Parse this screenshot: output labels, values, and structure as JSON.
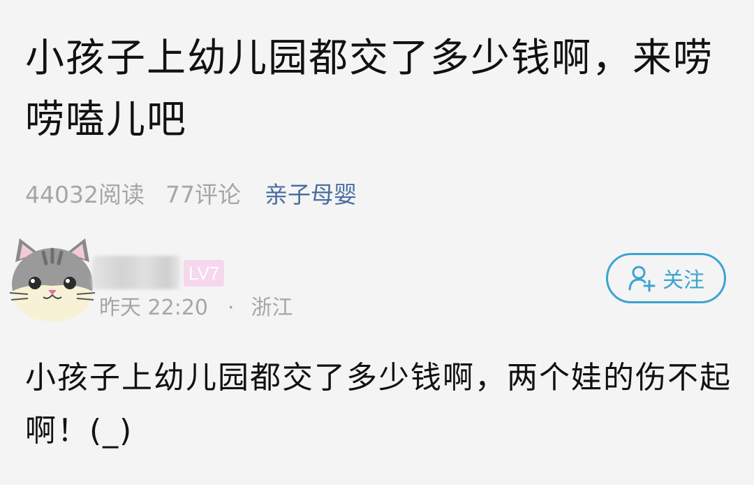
{
  "post": {
    "title": "小孩子上幼儿园都交了多少钱啊，来唠唠嗑儿吧",
    "reads": "44032阅读",
    "comments": "77评论",
    "category": "亲子母婴"
  },
  "comment": {
    "level": "LV7",
    "time": "昨天 22:20",
    "separator": "·",
    "location": "浙江",
    "follow_label": "关注",
    "text": "小孩子上幼儿园都交了多少钱啊，两个娃的伤不起啊！(_)"
  },
  "colors": {
    "background": "#f4f4f4",
    "meta_gray": "#a6a6a6",
    "category_blue": "#4a6ea1",
    "follow_blue": "#3aa3d2",
    "level_pink": "#f6d7ee"
  },
  "icons": {
    "avatar": "cat-avatar",
    "follow": "add-user-icon"
  }
}
